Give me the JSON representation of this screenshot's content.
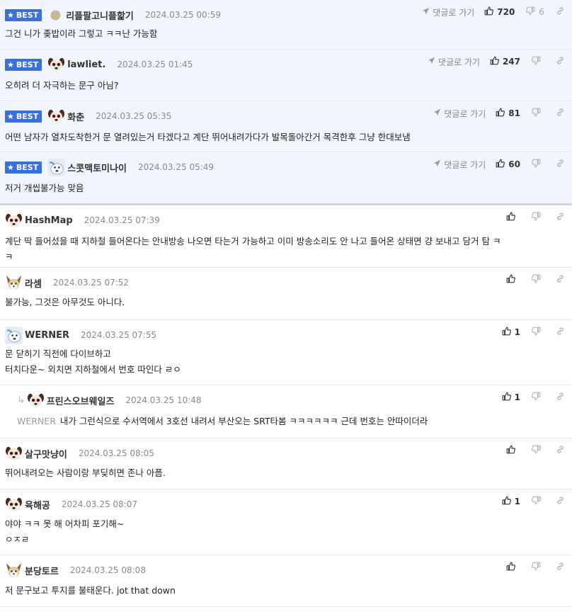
{
  "labels": {
    "best": "BEST",
    "goto_reply": "댓글로 가기"
  },
  "comments": [
    {
      "nick": "리플팔고니플핥기",
      "date": "2024.03.25 00:59",
      "text": "그건 니가 좆밥이라 그렇고 ㅋㅋ난 가능함",
      "likes": "720",
      "dislikes": "6",
      "best": true,
      "avatar": "dot-avatar"
    },
    {
      "nick": "lawliet.",
      "date": "2024.03.25 01:45",
      "text": "오히려 더 자극하는 문구 아님?",
      "likes": "247",
      "dislikes": "",
      "best": true,
      "avatar": "dog-avatar"
    },
    {
      "nick": "화춘",
      "date": "2024.03.25 05:35",
      "text": "어떤 남자가 열차도착한거 문 열려있는거 타겠다고 계단 뛰어내려가다가 발목돌아간거 목격한후 그냥 한대보냄",
      "likes": "81",
      "dislikes": "",
      "best": true,
      "avatar": "dog-avatar"
    },
    {
      "nick": "스콧맥토미나이",
      "date": "2024.03.25 05:49",
      "text": "저거 개씹불가능 맞음",
      "likes": "60",
      "dislikes": "",
      "best": true,
      "avatar": "blue-avatar"
    },
    {
      "nick": "HashMap",
      "date": "2024.03.25 07:39",
      "text": "계단 딱 들어섰을 때 지하철 들어온다는 안내방송 나오면 타는거 가능하고 이미 방송소리도 안 나고 들어온 상태면 걍 보내고 담거 탐 ㅋ\nㅋ",
      "likes": "",
      "dislikes": "",
      "avatar": "dog-avatar"
    },
    {
      "nick": "라셈",
      "date": "2024.03.25 07:52",
      "text": "불가능, 그것은 아무것도 아니다.",
      "likes": "",
      "dislikes": "",
      "avatar": "fox-avatar"
    },
    {
      "nick": "WERNER",
      "date": "2024.03.25 07:55",
      "text": "문 닫히기 직전에 다이브하고\n터치다운~ 외치면 지하철에서 번호 따인다 ㄹㅇ",
      "likes": "1",
      "dislikes": "",
      "avatar": "blue-avatar"
    },
    {
      "nick": "프린스오브웨일즈",
      "date": "2024.03.25 10:48",
      "reply_to": "WERNER",
      "text": "내가 그런식으로 수서역에서 3호선 내려서 부산오는 SRT타봄 ㅋㅋㅋㅋㅋㅋ 근데 번호는 안따이더라",
      "likes": "1",
      "dislikes": "",
      "reply": true,
      "avatar": "dog-avatar"
    },
    {
      "nick": "살구맛냥이",
      "date": "2024.03.25 08:05",
      "text": "뛰어내려오는 사람이랑 부딪히면 존나 아픔.",
      "likes": "",
      "dislikes": "",
      "avatar": "dog-avatar"
    },
    {
      "nick": "육해공",
      "date": "2024.03.25 08:07",
      "text": "야야 ㅋㅋ 못 해 어차피 포기해~\nㅇㅈㄹ",
      "likes": "1",
      "dislikes": "",
      "avatar": "dog-avatar"
    },
    {
      "nick": "분당토르",
      "date": "2024.03.25 08:08",
      "text": "저 문구보고 투지를 불태운다. jot that down",
      "likes": "",
      "dislikes": "",
      "avatar": "fox-avatar"
    }
  ]
}
